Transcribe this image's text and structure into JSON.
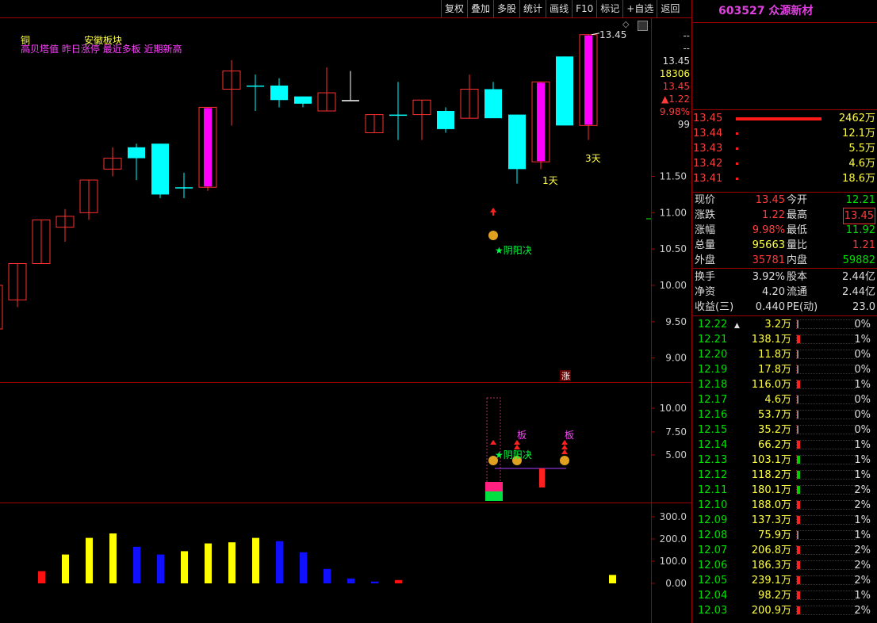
{
  "toolbar": [
    "复权",
    "叠加",
    "多股",
    "统计",
    "画线",
    "F10",
    "标记",
    "+自选",
    "返回"
  ],
  "stock": {
    "code": "603527",
    "name": "众源新材"
  },
  "labels": {
    "top_left": "铜",
    "sector": "安徽板块",
    "tags": "高贝塔值 昨日涨停 最近多板 近期新高",
    "high_mark": "13.45",
    "one_day": "1天",
    "three_day": "3天",
    "yinyang": "★阴阳决",
    "zhang": "涨",
    "ban1": "板",
    "ban2": "板",
    "yinyang2": "★阴阳决"
  },
  "price_axis": {
    "top": [
      "--",
      "--",
      "13.45",
      "18306",
      "13.45",
      "▲1.22",
      "9.98%",
      "99"
    ],
    "ticks": [
      "11.50",
      "11.00",
      "10.50",
      "10.00",
      "9.50",
      "9.00"
    ]
  },
  "ind_axis": [
    "10.00",
    "7.50",
    "5.00"
  ],
  "vol_axis": [
    "300.0",
    "200.0",
    "100.0",
    "0.00"
  ],
  "colors": {
    "up": "#ff3030",
    "down": "#00ffff",
    "magenta": "#ff00ff",
    "yellow": "#ffff00",
    "blue": "#1010ff"
  },
  "chart_data": {
    "type": "candlestick",
    "ylim": [
      8.8,
      13.6
    ],
    "candles": [
      {
        "o": 9.8,
        "c": 10.3,
        "h": 10.3,
        "l": 9.7,
        "t": "up"
      },
      {
        "o": 10.3,
        "c": 10.9,
        "h": 10.9,
        "l": 10.3,
        "t": "up"
      },
      {
        "o": 10.8,
        "c": 10.95,
        "h": 11.05,
        "l": 10.6,
        "t": "up"
      },
      {
        "o": 11.0,
        "c": 11.45,
        "h": 11.45,
        "l": 10.9,
        "t": "up"
      },
      {
        "o": 11.6,
        "c": 11.75,
        "h": 11.9,
        "l": 11.5,
        "t": "up"
      },
      {
        "o": 11.75,
        "c": 11.9,
        "h": 11.95,
        "l": 11.45,
        "t": "down"
      },
      {
        "o": 11.95,
        "c": 11.25,
        "h": 11.95,
        "l": 11.2,
        "t": "down"
      },
      {
        "o": 11.35,
        "c": 11.35,
        "h": 11.55,
        "l": 11.2,
        "t": "flat_down"
      },
      {
        "o": 11.35,
        "c": 12.45,
        "h": 12.45,
        "l": 11.3,
        "t": "limit"
      },
      {
        "o": 12.7,
        "c": 12.95,
        "h": 13.1,
        "l": 12.2,
        "t": "up"
      },
      {
        "o": 12.75,
        "c": 12.75,
        "h": 12.9,
        "l": 12.4,
        "t": "flat_down"
      },
      {
        "o": 12.75,
        "c": 12.55,
        "h": 12.85,
        "l": 12.45,
        "t": "down"
      },
      {
        "o": 12.6,
        "c": 12.5,
        "h": 12.6,
        "l": 12.45,
        "t": "down"
      },
      {
        "o": 12.4,
        "c": 12.65,
        "h": 13.0,
        "l": 12.4,
        "t": "up"
      },
      {
        "o": 12.55,
        "c": 12.55,
        "h": 12.95,
        "l": 12.55,
        "t": "flat_white"
      },
      {
        "o": 12.1,
        "c": 12.35,
        "h": 12.35,
        "l": 12.1,
        "t": "up"
      },
      {
        "o": 12.35,
        "c": 12.35,
        "h": 12.8,
        "l": 12.0,
        "t": "flat_down"
      },
      {
        "o": 12.35,
        "c": 12.55,
        "h": 12.55,
        "l": 12.0,
        "t": "up"
      },
      {
        "o": 12.4,
        "c": 12.15,
        "h": 12.45,
        "l": 12.1,
        "t": "down"
      },
      {
        "o": 12.3,
        "c": 12.7,
        "h": 12.9,
        "l": 12.3,
        "t": "up"
      },
      {
        "o": 12.7,
        "c": 12.3,
        "h": 12.8,
        "l": 12.3,
        "t": "down"
      },
      {
        "o": 12.35,
        "c": 11.6,
        "h": 12.35,
        "l": 11.4,
        "t": "down"
      },
      {
        "o": 11.7,
        "c": 12.8,
        "h": 12.8,
        "l": 11.6,
        "t": "limit"
      },
      {
        "o": 13.15,
        "c": 12.2,
        "h": 13.15,
        "l": 12.2,
        "t": "down"
      },
      {
        "o": 12.2,
        "c": 13.45,
        "h": 13.45,
        "l": 12.0,
        "t": "limit"
      }
    ],
    "volume": [
      {
        "v": 55,
        "t": "red"
      },
      {
        "v": 130,
        "t": "yellow"
      },
      {
        "v": 205,
        "t": "yellow"
      },
      {
        "v": 225,
        "t": "yellow"
      },
      {
        "v": 165,
        "t": "blue"
      },
      {
        "v": 130,
        "t": "blue"
      },
      {
        "v": 145,
        "t": "yellow"
      },
      {
        "v": 180,
        "t": "yellow"
      },
      {
        "v": 185,
        "t": "yellow"
      },
      {
        "v": 205,
        "t": "yellow"
      },
      {
        "v": 190,
        "t": "blue"
      },
      {
        "v": 140,
        "t": "blue"
      },
      {
        "v": 65,
        "t": "blue"
      },
      {
        "v": 22,
        "t": "blue"
      },
      {
        "v": 8,
        "t": "blue"
      },
      {
        "v": 15,
        "t": "red"
      },
      {
        "v": 0,
        "t": "none"
      },
      {
        "v": 0,
        "t": "none"
      },
      {
        "v": 0,
        "t": "none"
      },
      {
        "v": 0,
        "t": "none"
      },
      {
        "v": 0,
        "t": "none"
      },
      {
        "v": 0,
        "t": "none"
      },
      {
        "v": 0,
        "t": "none"
      },
      {
        "v": 0,
        "t": "none"
      },
      {
        "v": 38,
        "t": "yellow"
      }
    ],
    "vol_ylim": [
      0,
      320
    ]
  },
  "order_book": [
    {
      "price": "13.45",
      "vol": "2462万",
      "bar": 1.0
    },
    {
      "price": "13.44",
      "vol": "12.1万",
      "bar": 0.0
    },
    {
      "price": "13.43",
      "vol": "5.5万",
      "bar": 0.0
    },
    {
      "price": "13.42",
      "vol": "4.6万",
      "bar": 0.0
    },
    {
      "price": "13.41",
      "vol": "18.6万",
      "bar": 0.0
    }
  ],
  "quote": [
    {
      "l1": "现价",
      "v1": "13.45",
      "c1": "red",
      "l2": "今开",
      "v2": "12.21",
      "c2": "grn"
    },
    {
      "l1": "涨跌",
      "v1": "1.22",
      "c1": "red",
      "l2": "最高",
      "v2": "13.45",
      "c2": "red"
    },
    {
      "l1": "涨幅",
      "v1": "9.98%",
      "c1": "red",
      "l2": "最低",
      "v2": "11.92",
      "c2": "grn"
    },
    {
      "l1": "总量",
      "v1": "95663",
      "c1": "yel",
      "l2": "量比",
      "v2": "1.21",
      "c2": "red"
    },
    {
      "l1": "外盘",
      "v1": "35781",
      "c1": "red",
      "l2": "内盘",
      "v2": "59882",
      "c2": "grn"
    }
  ],
  "fund": [
    {
      "l1": "换手",
      "v1": "3.92%",
      "l2": "股本",
      "v2": "2.44亿"
    },
    {
      "l1": "净资",
      "v1": "4.20",
      "l2": "流通",
      "v2": "2.44亿"
    },
    {
      "l1": "收益(三)",
      "v1": "0.440",
      "l2": "PE(动)",
      "v2": "23.0"
    }
  ],
  "price_dist": [
    {
      "p": "12.22",
      "v": "3.2万",
      "pct": "0%",
      "b": 0
    },
    {
      "p": "12.21",
      "v": "138.1万",
      "pct": "1%",
      "b": 1
    },
    {
      "p": "12.20",
      "v": "11.8万",
      "pct": "0%",
      "b": 0
    },
    {
      "p": "12.19",
      "v": "17.8万",
      "pct": "0%",
      "b": 0
    },
    {
      "p": "12.18",
      "v": "116.0万",
      "pct": "1%",
      "b": 1
    },
    {
      "p": "12.17",
      "v": "4.6万",
      "pct": "0%",
      "b": 0
    },
    {
      "p": "12.16",
      "v": "53.7万",
      "pct": "0%",
      "b": 0
    },
    {
      "p": "12.15",
      "v": "35.2万",
      "pct": "0%",
      "b": 0
    },
    {
      "p": "12.14",
      "v": "66.2万",
      "pct": "1%",
      "b": 1
    },
    {
      "p": "12.13",
      "v": "103.1万",
      "pct": "1%",
      "b": 2
    },
    {
      "p": "12.12",
      "v": "118.2万",
      "pct": "1%",
      "b": 2
    },
    {
      "p": "12.11",
      "v": "180.1万",
      "pct": "2%",
      "b": 2
    },
    {
      "p": "12.10",
      "v": "188.0万",
      "pct": "2%",
      "b": 1
    },
    {
      "p": "12.09",
      "v": "137.3万",
      "pct": "1%",
      "b": 1
    },
    {
      "p": "12.08",
      "v": "75.9万",
      "pct": "1%",
      "b": 0
    },
    {
      "p": "12.07",
      "v": "206.8万",
      "pct": "2%",
      "b": 1
    },
    {
      "p": "12.06",
      "v": "186.3万",
      "pct": "2%",
      "b": 1
    },
    {
      "p": "12.05",
      "v": "239.1万",
      "pct": "2%",
      "b": 1
    },
    {
      "p": "12.04",
      "v": "98.2万",
      "pct": "1%",
      "b": 1
    },
    {
      "p": "12.03",
      "v": "200.9万",
      "pct": "2%",
      "b": 1
    }
  ]
}
